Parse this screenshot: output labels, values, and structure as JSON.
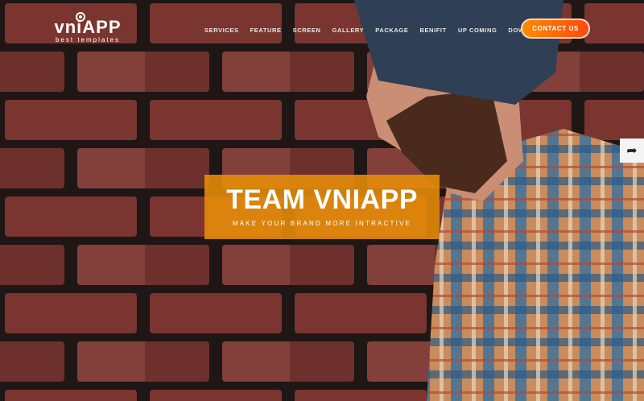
{
  "logo": {
    "mark": "vniAPP",
    "tagline": "best templates"
  },
  "nav": {
    "items": [
      "SERVICES",
      "FEATURE",
      "SCREEN",
      "GALLERY",
      "PACKAGE",
      "BENIFIT",
      "UP COMING",
      "DOWNLOAD APP"
    ],
    "contact": "CONTACT US"
  },
  "hero": {
    "title": "TEAM VNIAPP",
    "subtitle": "MAKE YOUR BRAND MORE INTRACTIVE"
  },
  "share": {
    "icon": "share-icon"
  },
  "colors": {
    "accent": "#e88e08",
    "button": "#ff6a05"
  }
}
